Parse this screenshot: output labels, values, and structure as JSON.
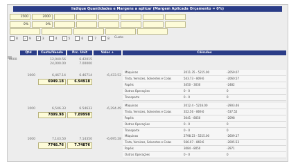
{
  "title": "Indique Quantidades e Margens a aplicar (Margem Aplicada Orçamento = 0%)",
  "params": {
    "row1": [
      "1500",
      "2000",
      "",
      "",
      "",
      "",
      "",
      ""
    ],
    "row2": [
      "%",
      "%",
      "%",
      "%",
      "%",
      "%",
      "%",
      "%"
    ],
    "row2_values": [
      "0%",
      "0%",
      "",
      "",
      "",
      "",
      "",
      ""
    ],
    "checkboxes": [
      "8",
      "9",
      "3",
      "4",
      "5",
      "6",
      "7",
      "8"
    ],
    "custo_label": "Custo"
  },
  "headers": {
    "qtd": "Qtd",
    "custo": "Custo/Venda",
    "prc": "Prc. Unit",
    "valor": "Valor +",
    "calc": "Cálculos"
  },
  "top_row": {
    "qtd": "0000",
    "v1": "12,040.56",
    "v2": "24,000.00",
    "p1": "6.42015",
    "p2": "7.00000"
  },
  "groups": [
    {
      "qtd": "1000",
      "custo": "6,467.14",
      "venda": "6949.18",
      "prc1": "6.46714",
      "prc2": "6.94918",
      "valor": "-6,433.52",
      "lines": [
        {
          "label": "Máquinas",
          "v": "2011.35 - 5215.00",
          "t": "-2059.07"
        },
        {
          "label": "Tinta, Vernizes, Solventes e Colas",
          "v": "543.73 - 809.6",
          "t": "-2060.57"
        },
        {
          "label": "Papéis",
          "v": "3450 - 3030",
          "t": "-2482"
        },
        {
          "label": "Outras Operações",
          "v": "0 - 0",
          "t": "0"
        },
        {
          "label": "Transporte",
          "v": "0 - 0",
          "t": "0"
        }
      ]
    },
    {
      "qtd": "1000",
      "custo": "6,546.33",
      "venda": "7899.98",
      "prc1": "6.54633",
      "prc2": "7.89998",
      "valor": "-6,294.49",
      "lines": [
        {
          "label": "Máquinas",
          "v": "2012.4 - 5216.00",
          "t": "-2903.46"
        },
        {
          "label": "Tinta, Vernizes, Solventes e Colas",
          "v": "352.56 - 869.6",
          "t": "-537.52"
        },
        {
          "label": "Papéis",
          "v": "3041 - 8050",
          "t": "-2098"
        },
        {
          "label": "Outras Operações",
          "v": "0 - 0",
          "t": "0"
        },
        {
          "label": "Transporte",
          "v": "0 - 0",
          "t": "0"
        }
      ]
    },
    {
      "qtd": "1000",
      "custo": "7,143.50",
      "venda": "7748.76",
      "prc1": "7.14350",
      "prc2": "7.74876",
      "valor": "-6,695.28",
      "lines": [
        {
          "label": "Máquinas",
          "v": "2798.23 - 5215.00",
          "t": "-2609.17"
        },
        {
          "label": "Tinta, Vernizes, Solventes e Colas",
          "v": "566.07 - 869.6",
          "t": "-2005.53"
        },
        {
          "label": "Papéis",
          "v": "3084 - 8050",
          "t": "-2971"
        },
        {
          "label": "Outras Operações",
          "v": "0 - 0",
          "t": "0"
        },
        {
          "label": "Transporte",
          "v": "0 - 0",
          "t": "0"
        }
      ]
    }
  ],
  "colors": {
    "header": "#2a3c87",
    "input": "#fdfbd8"
  }
}
